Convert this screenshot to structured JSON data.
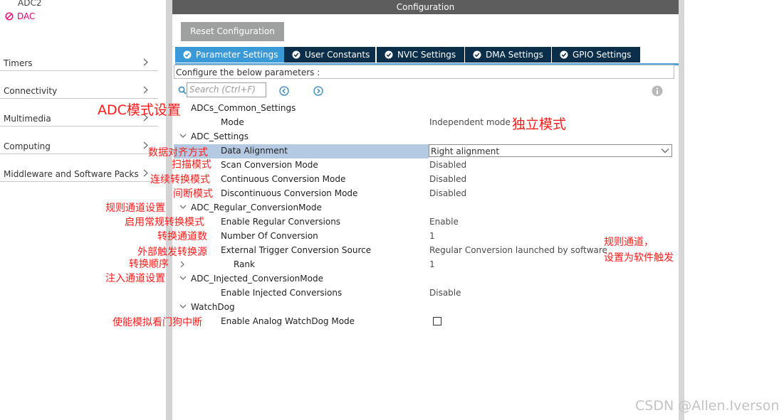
{
  "sidebar": {
    "partial_item": "ADC2",
    "selected_item": "DAC",
    "categories": [
      "Timers",
      "Connectivity",
      "Multimedia",
      "Computing",
      "Middleware and Software Packs"
    ]
  },
  "panel": {
    "title": "Configuration",
    "reset_button": "Reset Configuration",
    "tabs": [
      "Parameter Settings",
      "User Constants",
      "NVIC Settings",
      "DMA Settings",
      "GPIO Settings"
    ],
    "active_tab": "Parameter Settings",
    "description": "Configure the below parameters :",
    "search_placeholder": "Search (Ctrl+F)"
  },
  "params": {
    "common_group": "ADCs_Common_Settings",
    "mode_label": "Mode",
    "mode_value": "Independent mode",
    "settings_group": "ADC_Settings",
    "data_alignment_label": "Data Alignment",
    "data_alignment_value": "Right alignment",
    "scan_label": "Scan Conversion Mode",
    "scan_value": "Disabled",
    "continuous_label": "Continuous Conversion Mode",
    "continuous_value": "Disabled",
    "discontinuous_label": "Discontinuous Conversion Mode",
    "discontinuous_value": "Disabled",
    "regular_group": "ADC_Regular_ConversionMode",
    "enable_regular_label": "Enable Regular Conversions",
    "enable_regular_value": "Enable",
    "num_conv_label": "Number Of Conversion",
    "num_conv_value": "1",
    "ext_trigger_label": "External Trigger Conversion Source",
    "ext_trigger_value": "Regular Conversion launched by software",
    "rank_label": "Rank",
    "rank_value": "1",
    "injected_group": "ADC_Injected_ConversionMode",
    "enable_injected_label": "Enable Injected Conversions",
    "enable_injected_value": "Disable",
    "watchdog_group": "WatchDog",
    "watchdog_label": "Enable Analog WatchDog Mode",
    "watchdog_checked": false
  },
  "annotations": {
    "adc_mode": "ADC模式设置",
    "independent": "独立模式",
    "data_align": "数据对齐方式",
    "scan": "扫描模式",
    "continuous": "连续转换模式",
    "discontinuous": "间断模式",
    "regular": "规则通道设置",
    "enable_regular": "启用常规转换模式",
    "num_conv": "转换通道数",
    "ext_trigger": "外部触发转换源",
    "rank": "转换顺序",
    "injected": "注入通道设置",
    "watchdog": "使能模拟看门狗中断",
    "note_line1": "规则通道，",
    "note_line2": "设置为软件触发"
  },
  "watermark": "CSDN @Allen.Iverson",
  "colors": {
    "annotation": "#ff1a1a",
    "selected_item": "#e5007a",
    "active_tab": "#3a9ad8",
    "tab": "#0b2e4a",
    "title_bar": "#5d5d5d",
    "highlight_row": "#b4c9e2"
  }
}
